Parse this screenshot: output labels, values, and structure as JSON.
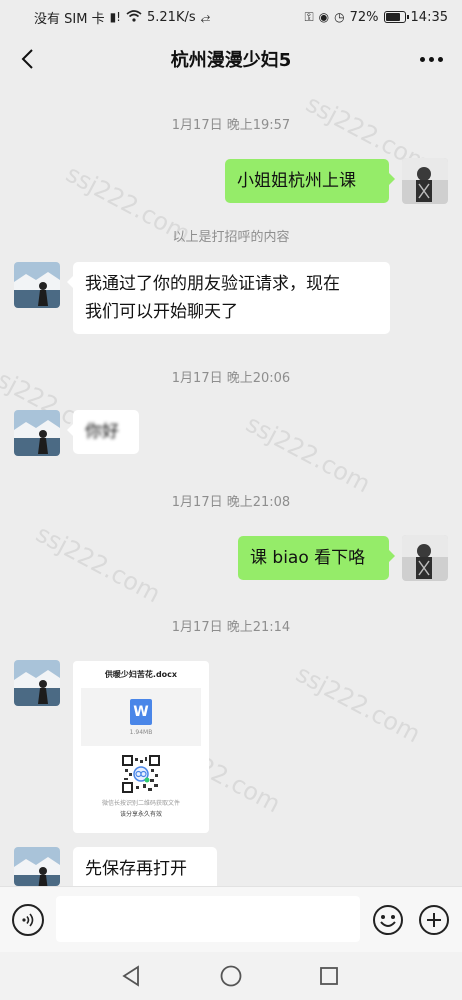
{
  "status_bar": {
    "carrier": "没有 SIM 卡",
    "speed": "5.21K/s",
    "battery": "72%",
    "time": "14:35"
  },
  "header": {
    "title": "杭州漫漫少妇5"
  },
  "messages": {
    "ts1": "1月17日 晚上19:57",
    "m1": "小姐姐杭州上课",
    "greeting_note": "以上是打招呼的内容",
    "m2_line1": "我通过了你的朋友验证请求，现在",
    "m2_line2": "我们可以开始聊天了",
    "ts2": "1月17日 晚上20:06",
    "m3": "你好",
    "ts3": "1月17日 晚上21:08",
    "m4": "课 biao 看下咯",
    "ts4": "1月17日 晚上21:14",
    "file": {
      "name": "供暖少妇苦花.docx",
      "size": "1.94MB",
      "qr_tip": "微信长按识别二维码获取文件",
      "note": "该分享永久有效"
    },
    "m5": "先保存再打开"
  },
  "input": {
    "value": ""
  },
  "watermark": "ssj222.com",
  "colors": {
    "background": "#ededed",
    "outgoing_bubble": "#95ec69",
    "incoming_bubble": "#ffffff"
  }
}
